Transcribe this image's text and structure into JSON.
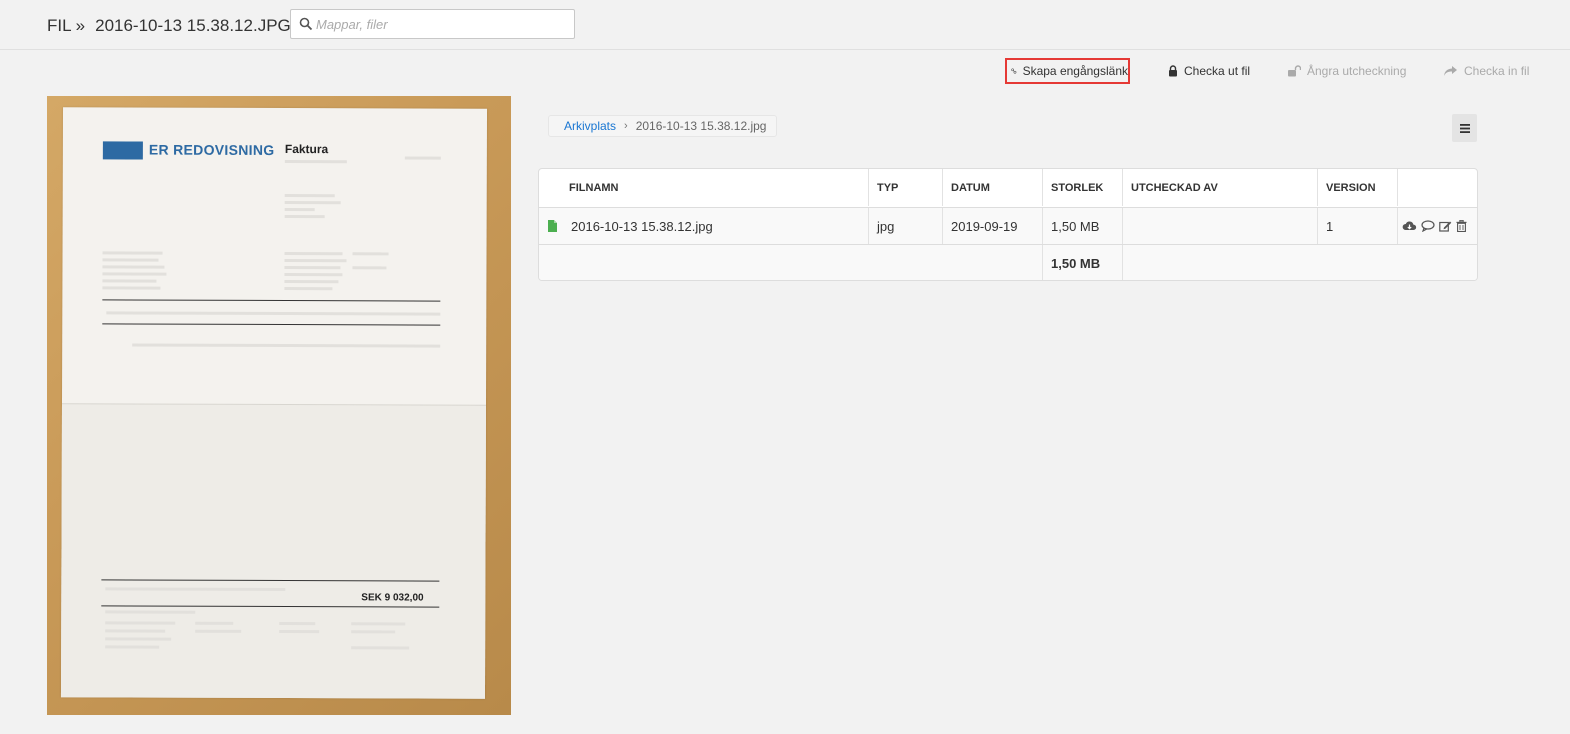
{
  "header": {
    "prefix": "FIL »",
    "filename": "2016-10-13 15.38.12.JPG",
    "search_placeholder": "Mappar, filer"
  },
  "toolbar": {
    "create_link": "Skapa engångslänk",
    "checkout": "Checka ut fil",
    "undo_checkout": "Ångra utcheckning",
    "checkin": "Checka in fil"
  },
  "preview": {
    "logo_text": "ER REDOVISNING",
    "doc_title": "Faktura",
    "total_label": "SEK   9 032,00"
  },
  "breadcrumb": {
    "root": "Arkivplats",
    "current": "2016-10-13 15.38.12.jpg"
  },
  "table": {
    "headers": [
      "FILNAMN",
      "TYP",
      "DATUM",
      "STORLEK",
      "UTCHECKAD AV",
      "VERSION"
    ],
    "row": {
      "filename": "2016-10-13 15.38.12.jpg",
      "type": "jpg",
      "date": "2019-09-19",
      "size": "1,50 MB",
      "checked_out_by": "",
      "version": "1"
    },
    "total_size": "1,50 MB"
  },
  "icons": {
    "search": "search-icon",
    "link": "link-icon",
    "lock": "lock-icon",
    "unlock": "unlock-icon",
    "share": "share-arrow-icon",
    "menu": "hamburger-icon",
    "file": "file-icon",
    "download": "cloud-download-icon",
    "comment": "comment-icon",
    "edit": "edit-icon",
    "delete": "trash-icon"
  },
  "colors": {
    "accent": "#1976d2",
    "highlight_border": "#e53935",
    "file_icon": "#4caf50"
  }
}
